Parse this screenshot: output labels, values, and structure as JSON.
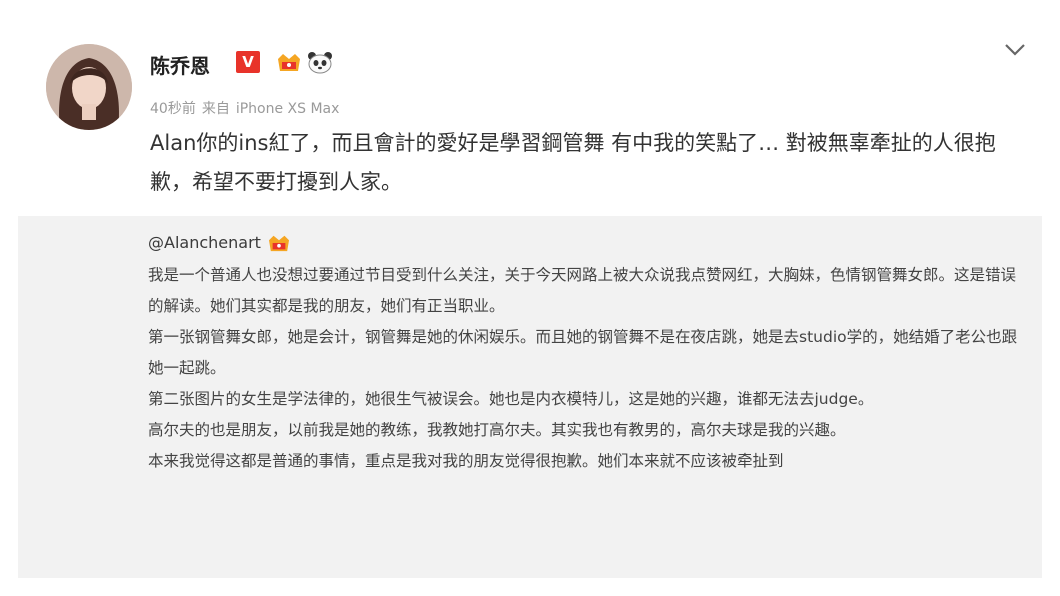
{
  "post": {
    "username": "陈乔恩",
    "verified_label": "V",
    "meta": {
      "time": "40秒前",
      "source_prefix": "来自",
      "device": "iPhone XS Max"
    },
    "text": "Alan你的ins紅了，而且會計的愛好是學習鋼管舞 有中我的笑點了… 對被無辜牽扯的人很抱歉，希望不要打擾到人家。"
  },
  "repost": {
    "author": "@Alanchenart",
    "paragraphs": [
      "我是一个普通人也没想过要通过节目受到什么关注，关于今天网路上被大众说我点赞网红，大胸妹，色情钢管舞女郎。这是错误的解读。她们其实都是我的朋友，她们有正当职业。",
      "第一张钢管舞女郎，她是会计，钢管舞是她的休闲娱乐。而且她的钢管舞不是在夜店跳，她是去studio学的，她结婚了老公也跟她一起跳。",
      "第二张图片的女生是学法律的，她很生气被误会。她也是内衣模特儿，这是她的兴趣，谁都无法去judge。",
      "高尔夫的也是朋友，以前我是她的教练，我教她打高尔夫。其实我也有教男的，高尔夫球是我的兴趣。",
      "本来我觉得这都是普通的事情，重点是我对我的朋友觉得很抱歉。她们本来就不应该被牵扯到"
    ]
  },
  "icons": {
    "avatar": "avatar",
    "verified": "verified-v-icon",
    "crown": "crown-badge-icon",
    "panda": "panda-badge-icon",
    "chevron": "chevron-down-icon"
  },
  "colors": {
    "verified": "#e8332a",
    "repost_bg": "#f2f2f2",
    "meta": "#9a9a9a"
  }
}
